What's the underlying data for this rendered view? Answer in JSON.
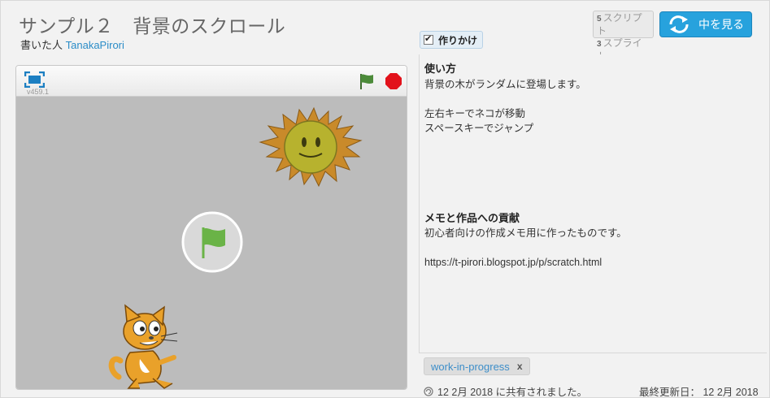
{
  "header": {
    "title": "サンプル２　背景のスクロール",
    "by_label": "書いた人",
    "author": "TanakaPirori",
    "wip_label": "作りかけ",
    "scripts_count": "5",
    "scripts_label": "スクリプト",
    "sprites_count": "3",
    "sprites_label": "スプライト",
    "see_inside_label": "中を見る"
  },
  "player": {
    "version": "v459.1"
  },
  "instructions": {
    "heading": "使い方",
    "body": "背景の木がランダムに登場します。\n\n左右キーでネコが移動\nスペースキーでジャンプ"
  },
  "notes": {
    "heading": "メモと作品への貢献",
    "body": "初心者向けの作成メモ用に作ったものです。\n\nhttps://t-pirori.blogspot.jp/p/scratch.html"
  },
  "tags": [
    {
      "label": "work-in-progress",
      "close": "x"
    }
  ],
  "footer": {
    "shared": "12 2月 2018 に共有されました。",
    "modified": "最終更新日： 12 2月 2018"
  },
  "colors": {
    "accent": "#27a2dd",
    "link": "#2a8cc7",
    "stage": "#bcbcbc",
    "flag": "#4c8b3a",
    "stop": "#e2121b"
  }
}
